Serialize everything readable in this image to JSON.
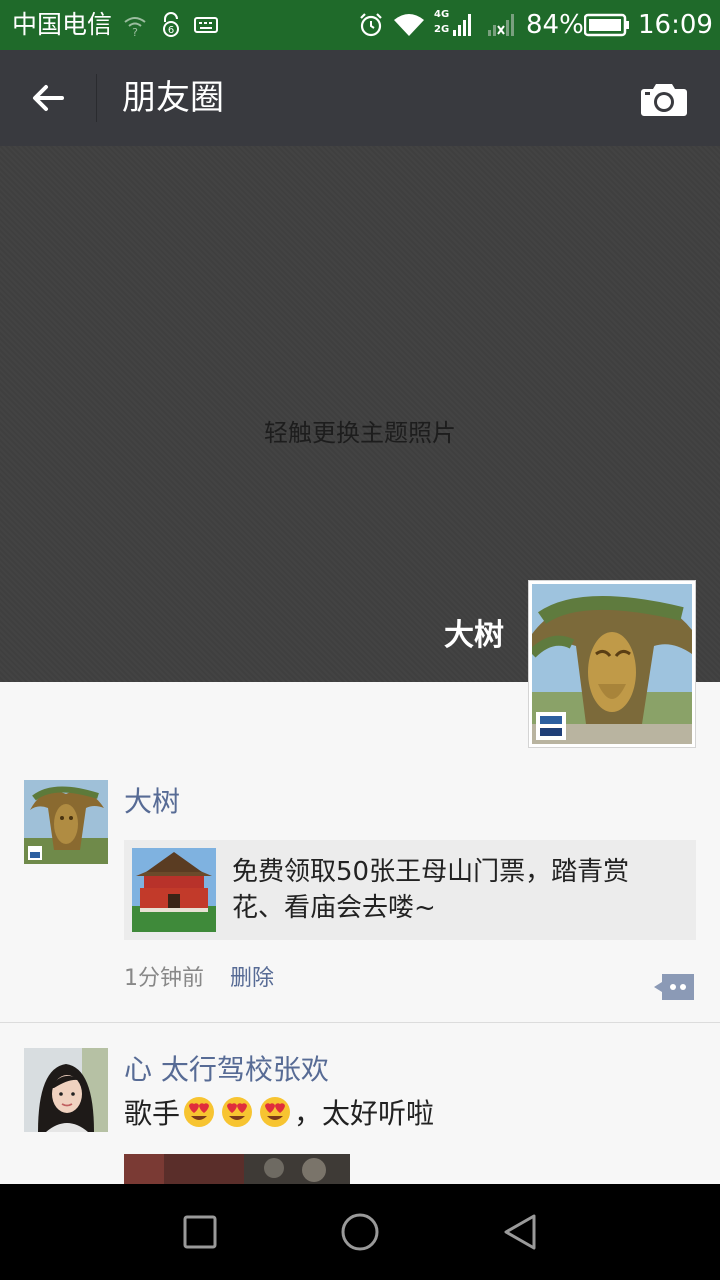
{
  "status_bar": {
    "carrier": "中国电信",
    "network_top": "4G",
    "network_bottom": "2G",
    "battery_percent": "84%",
    "time": "16:09"
  },
  "toolbar": {
    "title": "朋友圈",
    "back_icon": "arrow-left-icon",
    "camera_icon": "camera-icon"
  },
  "cover": {
    "hint": "轻触更换主题照片",
    "profile_name": "大树"
  },
  "feed": {
    "posts": [
      {
        "author": "大树",
        "link_title": "免费领取50张王母山门票，踏青赏花、看庙会去喽~",
        "time": "1分钟前",
        "delete_label": "删除"
      },
      {
        "author": "心  太行驾校张欢",
        "text_before": "歌手",
        "text_after": "，太好听啦",
        "emoji": "heart-eyes-emoji"
      }
    ]
  },
  "colors": {
    "status_bar": "#1f6a2a",
    "toolbar": "#393a3f",
    "link_blue": "#576b95",
    "cover": "#404040"
  }
}
